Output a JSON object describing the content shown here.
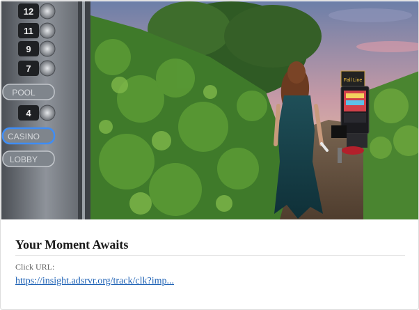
{
  "ad": {
    "title": "Your Moment Awaits",
    "click_url_label": "Click URL:",
    "click_url": "https://insight.adsrvr.org/track/clk?imp..."
  },
  "elevator": {
    "floor_labels": [
      "12",
      "11",
      "9",
      "7",
      "POOL",
      "4",
      "CASINO",
      "LOBBY"
    ],
    "highlighted": "CASINO"
  },
  "slot_machine": {
    "topper_text": "Fall Line"
  }
}
